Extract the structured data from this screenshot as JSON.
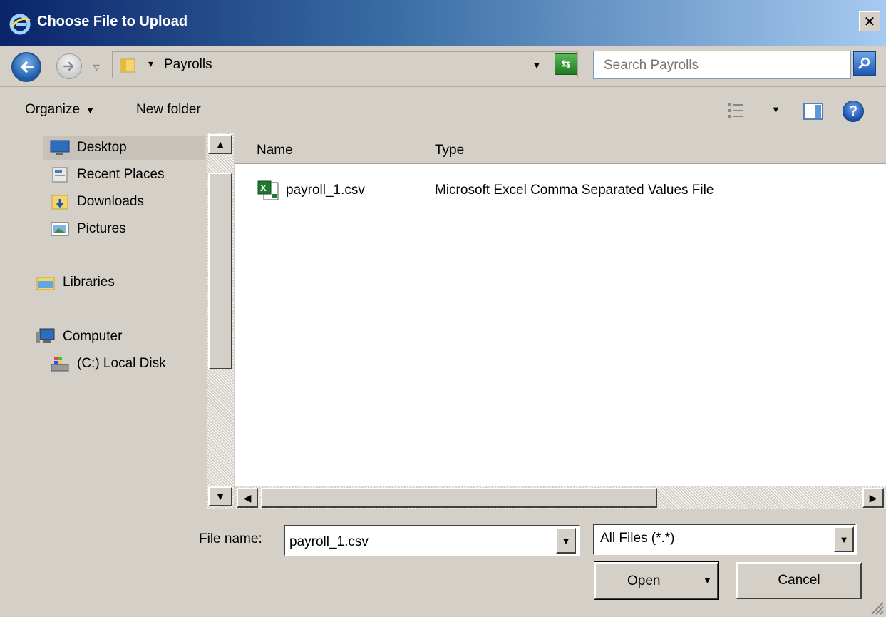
{
  "window": {
    "title": "Choose File to Upload",
    "close_label": "✕"
  },
  "address": {
    "path": "Payrolls",
    "search_placeholder": "Search Payrolls"
  },
  "toolbar": {
    "organize_label": "Organize",
    "new_folder_label": "New folder"
  },
  "nav": {
    "items": [
      {
        "label": "Desktop",
        "icon": "desktop-icon",
        "selected": true
      },
      {
        "label": "Recent Places",
        "icon": "recent-places-icon"
      },
      {
        "label": "Downloads",
        "icon": "downloads-folder-icon"
      },
      {
        "label": "Pictures",
        "icon": "pictures-icon"
      },
      {
        "label": "Libraries",
        "icon": "libraries-icon"
      },
      {
        "label": "Computer",
        "icon": "computer-icon"
      },
      {
        "label": "(C:) Local Disk",
        "icon": "local-disk-icon"
      }
    ]
  },
  "columns": {
    "name": "Name",
    "type": "Type"
  },
  "files": [
    {
      "name": "payroll_1.csv",
      "type": "Microsoft Excel Comma Separated Values File",
      "icon": "excel-csv-icon"
    }
  ],
  "bottom": {
    "file_name_label_pre": "File ",
    "file_name_label_u": "n",
    "file_name_label_post": "ame:",
    "file_name_value": "payroll_1.csv",
    "file_type_value": "All Files (*.*)",
    "open_label_u": "O",
    "open_label_rest": "pen",
    "cancel_label": "Cancel"
  }
}
